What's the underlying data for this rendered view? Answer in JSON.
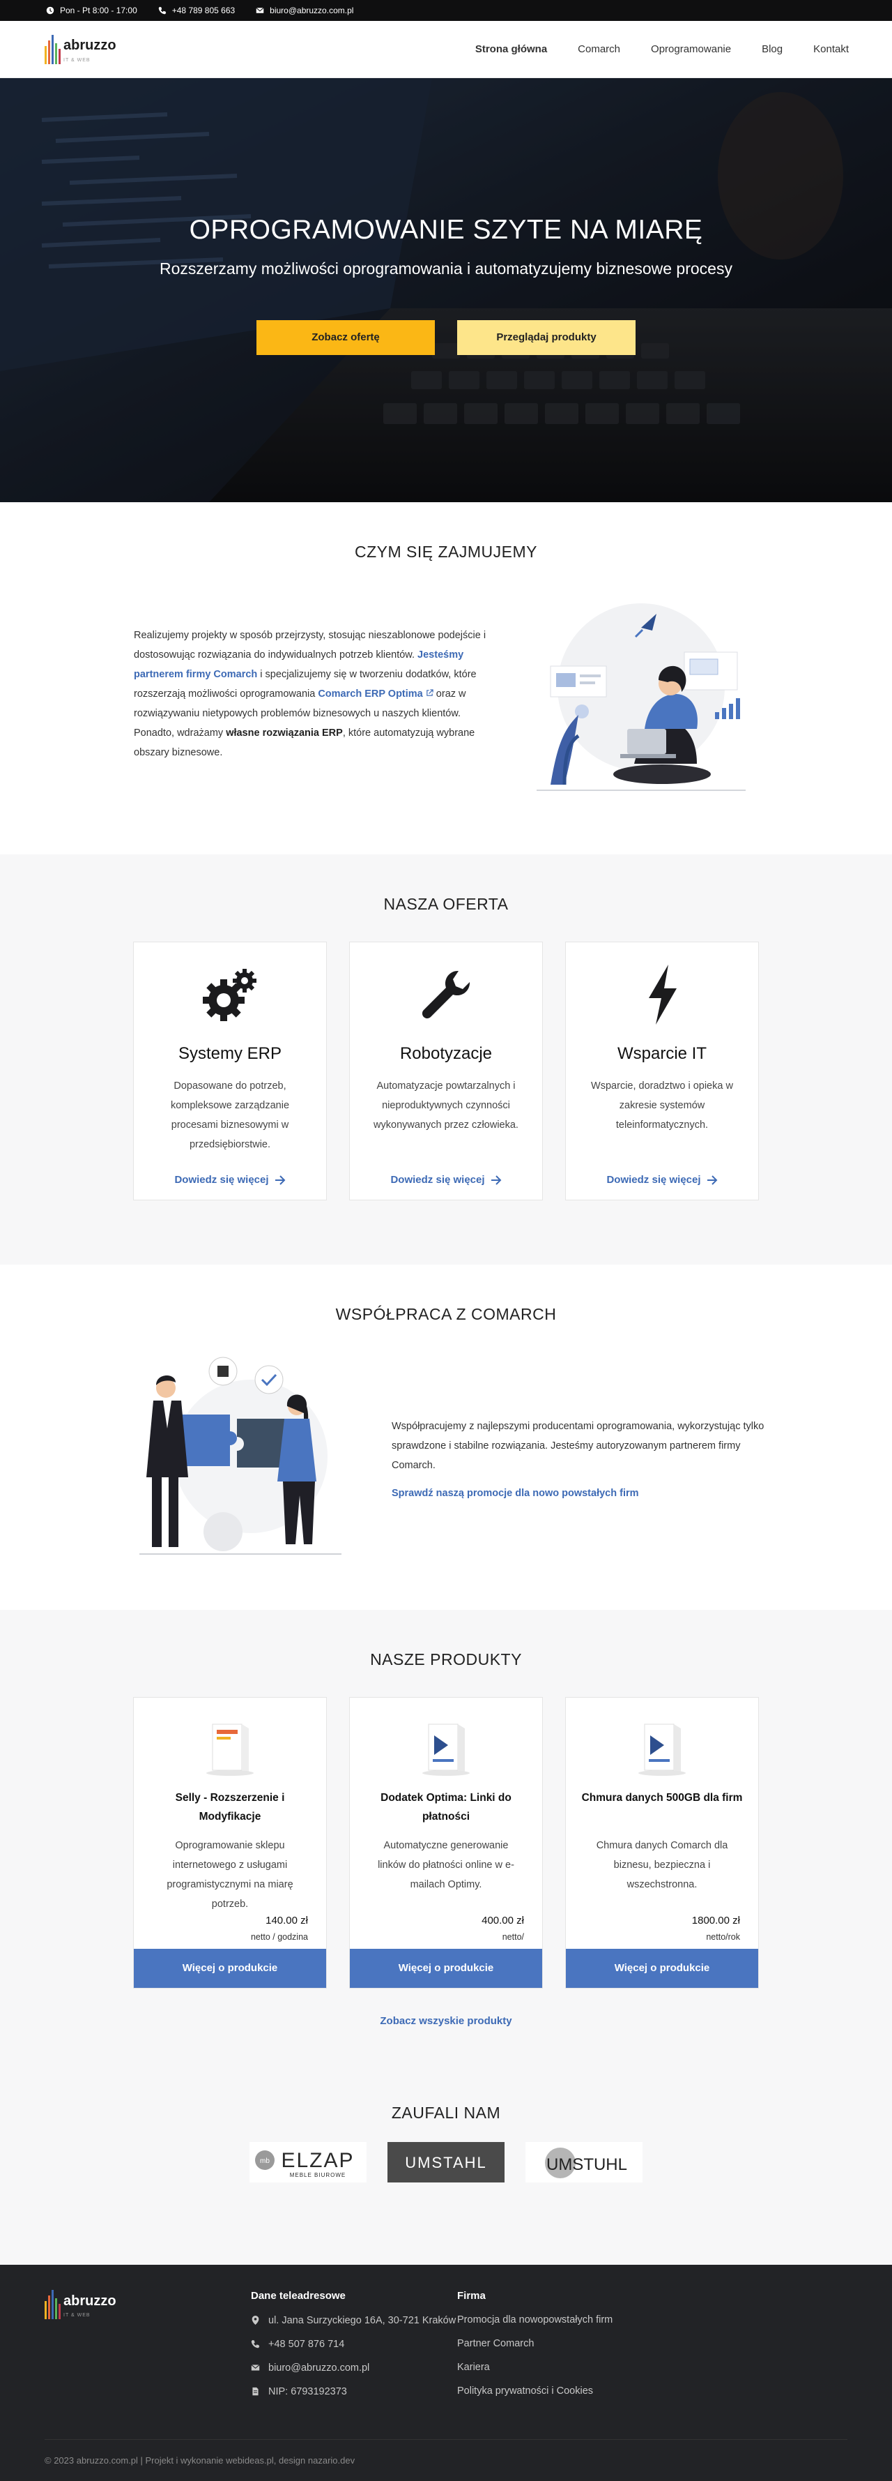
{
  "topbar": {
    "hours": "Pon - Pt 8:00 - 17:00",
    "phone": "+48 789 805 663",
    "email": "biuro@abruzzo.com.pl"
  },
  "logo": {
    "word": "abruzzo",
    "sub": "IT & WEB"
  },
  "nav": {
    "items": [
      "Strona główna",
      "Comarch",
      "Oprogramowanie",
      "Blog",
      "Kontakt"
    ]
  },
  "hero": {
    "title": "OPROGRAMOWANIE SZYTE NA MIARĘ",
    "subtitle": "Rozszerzamy możliwości oprogramowania i automatyzujemy biznesowe procesy",
    "btn_offer": "Zobacz ofertę",
    "btn_products": "Przeglądaj produkty",
    "colors": {
      "primary_button": "#fbb715",
      "secondary_button": "#fde58a"
    }
  },
  "about": {
    "title": "CZYM SIĘ ZAJMUJEMY",
    "t1": "Realizujemy projekty w sposób przejrzysty, stosując nieszablonowe podejście i dostosowując rozwiązania do indywidualnych potrzeb klientów. ",
    "link1": "Jesteśmy partnerem firmy Comarch",
    "t2": " i specjalizujemy się w tworzeniu dodatków, które rozszerzają możliwości oprogramowania ",
    "link2": "Comarch ERP Optima",
    "t3": " oraz w rozwiązywaniu nietypowych problemów biznesowych u naszych klientów. Ponadto, wdrażamy ",
    "bold": "własne rozwiązania ERP",
    "t4": ", które automatyzują wybrane obszary biznesowe."
  },
  "offer": {
    "title": "NASZA OFERTA",
    "more": "Dowiedz się więcej",
    "cards": [
      {
        "icon": "gears-icon",
        "title": "Systemy ERP",
        "text": "Dopasowane do potrzeb, kompleksowe zarządzanie procesami biznesowymi w przedsiębiorstwie."
      },
      {
        "icon": "wrench-icon",
        "title": "Robotyzacje",
        "text": "Automatyzacje powtarzalnych i nieproduktywnych czynności wykonywanych przez człowieka."
      },
      {
        "icon": "bolt-icon",
        "title": "Wsparcie IT",
        "text": "Wsparcie, doradztwo i opieka w zakresie systemów teleinformatycznych."
      }
    ]
  },
  "coop": {
    "title": "WSPÓŁPRACA Z COMARCH",
    "text": "Współpracujemy z najlepszymi producentami oprogramowania, wykorzystując tylko sprawdzone i stabilne rozwiązania. Jesteśmy autoryzowanym partnerem firmy Comarch.",
    "link": "Sprawdź naszą promocje dla nowo powstałych firm"
  },
  "products": {
    "title": "NASZE PRODUKTY",
    "button": "Więcej o produkcie",
    "all": "Zobacz wszyskie produkty",
    "items": [
      {
        "name": "Selly - Rozszerzenie i Modyfikacje",
        "desc": "Oprogramowanie sklepu internetowego z usługami programistycznymi na miarę potrzeb.",
        "price": "140.00 zł",
        "unit": "netto / godzina"
      },
      {
        "name": "Dodatek Optima: Linki do płatności",
        "desc": "Automatyczne generowanie linków do płatności online w e-mailach Optimy.",
        "price": "400.00 zł",
        "unit": "netto/"
      },
      {
        "name": "Chmura danych 500GB dla firm",
        "desc": "Chmura danych Comarch dla biznesu, bezpieczna i wszechstronna.",
        "price": "1800.00 zł",
        "unit": "netto/rok"
      }
    ]
  },
  "trust": {
    "title": "ZAUFALI NAM",
    "logos": [
      {
        "mark": "mb",
        "name": "ELZAP",
        "tag": "MEBLE BIUROWE"
      },
      {
        "name": "UMSTAHL"
      },
      {
        "name": "UMSTUHL"
      }
    ]
  },
  "footer": {
    "contact_title": "Dane teleadresowe",
    "address": "ul. Jana Surzyckiego 16A, 30-721 Kraków",
    "phone": "+48 507 876 714",
    "email": "biuro@abruzzo.com.pl",
    "nip": "NIP: 6793192373",
    "firm_title": "Firma",
    "links": [
      "Promocja dla nowopowstałych firm",
      "Partner Comarch",
      "Kariera",
      "Polityka prywatności i Cookies"
    ],
    "copyright": "© 2023 abruzzo.com.pl | Projekt i wykonanie webideas.pl, design nazario.dev"
  }
}
